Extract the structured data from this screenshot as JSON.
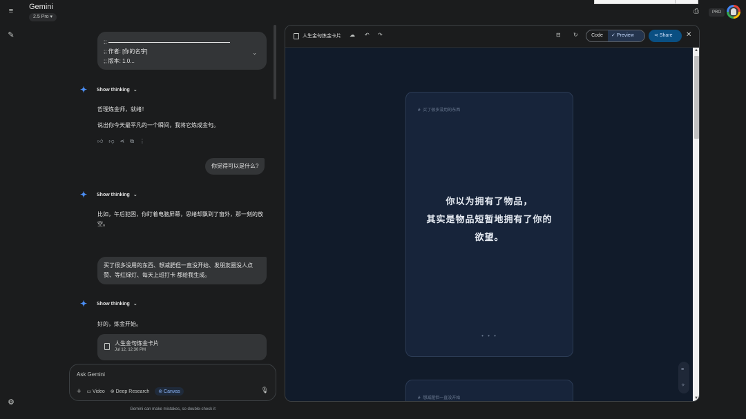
{
  "app": {
    "title": "Gemini",
    "model": "2.5 Pro",
    "pro_badge": "PRO"
  },
  "chat": {
    "code_snippet": {
      "line1_prefix": ";;",
      "line2": ";; 作者: [你的名字]",
      "line3": ";; 版本: 1.0..."
    },
    "thinking_label": "Show thinking",
    "response1": {
      "line1": "哲理炼金师，就绪！",
      "line2": "说出你今天最平凡的一个瞬间，我将它炼成金句。"
    },
    "user_msg1": "你觉得可以是什么?",
    "response2": "比如，午后犯困，你盯着电脑屏幕，思绪却飘到了窗外，那一刻的放空。",
    "user_msg2": "买了很多没用的东西、想减肥但一直没开始、发朋友圈没人点赞、等红绿灯、每天上班打卡 都给我生成。",
    "response3": "好的，炼金开始。",
    "canvas_card": {
      "title": "人生金句炼金卡片",
      "date": "Jul 12, 12:30 PM"
    }
  },
  "input": {
    "placeholder": "Ask Gemini",
    "tools": {
      "video": "Video",
      "deep_research": "Deep Research",
      "canvas": "Canvas"
    },
    "disclaimer": "Gemini can make mistakes, so double-check it"
  },
  "panel": {
    "title": "人生金句炼金卡片",
    "code_label": "Code",
    "preview_label": "Preview",
    "share_label": "Share",
    "card1": {
      "tag": "# 买了很多没用的东西",
      "quote_line1": "你以为拥有了物品，",
      "quote_line2": "其实是物品短暂地拥有了你的",
      "quote_line3": "欲望。",
      "dots": "• • •"
    },
    "card2": {
      "tag": "# 想减肥但一直没开始"
    }
  },
  "icons": {
    "menu": "menu-icon",
    "new_chat": "edit-icon",
    "settings": "gear-icon",
    "gem": "gemini-spark-icon",
    "upload_cloud": "cloud-icon",
    "undo": "undo-icon",
    "redo": "redo-icon"
  },
  "colors": {
    "background": "#1b1c1d",
    "accent": "#4b8ef5",
    "card_bg": "#17243a",
    "preview_bg": "#111b2a",
    "share": "#0a4f82"
  }
}
